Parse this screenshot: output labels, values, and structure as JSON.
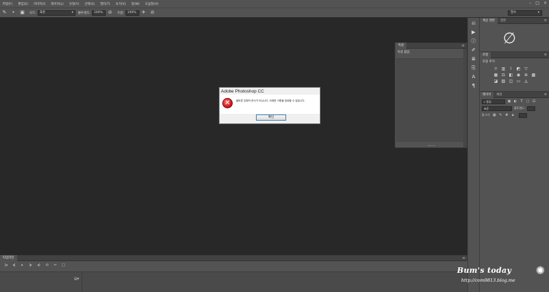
{
  "menubar": {
    "items": [
      "파일(F)",
      "편집(E)",
      "이미지(I)",
      "레이어(L)",
      "유형(Y)",
      "선택(S)",
      "필터(T)",
      "보기(V)",
      "창(W)",
      "도움말(H)"
    ],
    "window_controls": [
      "–",
      "□",
      "×"
    ]
  },
  "options": {
    "mode_label": "모드:",
    "mode_value": "표준",
    "opacity_label": "불투명도:",
    "opacity_value": "100%",
    "flow_label": "흐름:",
    "flow_value": "100%",
    "workspace": "필수"
  },
  "toolstrip": {
    "icons": [
      "history-icon",
      "play-icon",
      "info-icon",
      "brush-icon",
      "adjust-icon",
      "clone-icon",
      "type-icon",
      "paragraph-icon"
    ]
  },
  "color_panel": {
    "tabs": [
      "색상 견본",
      "견본"
    ]
  },
  "adjust_panel": {
    "tabs": [
      "조정"
    ],
    "title": "조정 추가"
  },
  "layers_panel": {
    "tabs": [
      "레이어",
      "채널"
    ],
    "kind_select": "종류",
    "blend_select": "표준",
    "opacity_label": "불투명도:",
    "lock_label": "잠그기:"
  },
  "props_panel": {
    "tabs": [
      "속성"
    ],
    "title": "속성 없음"
  },
  "dialog": {
    "title": "Adobe Photoshop CC",
    "message": "올바른 유형의 문서가 아닙니다. 요청한 사항을 완료할 수 없습니다.",
    "ok_label": "확인"
  },
  "timeline": {
    "tabs": [
      "타임라인"
    ],
    "controls": [
      "|◂",
      "◂|",
      "▸",
      "|▸",
      "◂)",
      "⟲",
      "✂",
      "□"
    ],
    "render_icon": "▤▾"
  },
  "watermark": {
    "title": "Bum's today",
    "url": "http://com9813.blog.me"
  }
}
